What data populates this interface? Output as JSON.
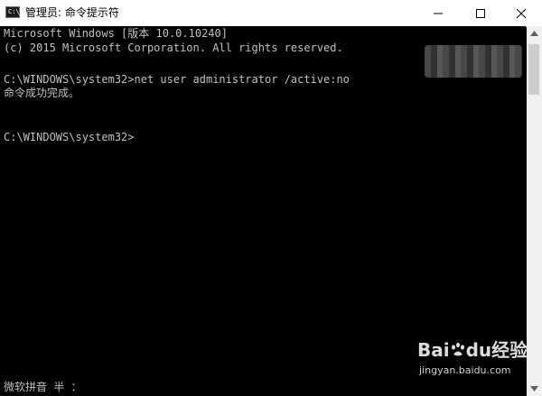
{
  "window": {
    "title": "管理员: 命令提示符",
    "icon": "console-icon",
    "icon_text": "C:\\_",
    "controls": {
      "minimize": "minimize-icon",
      "maximize": "maximize-icon",
      "close": "close-icon"
    }
  },
  "console": {
    "lines": [
      "Microsoft Windows [版本 10.0.10240]",
      "(c) 2015 Microsoft Corporation. All rights reserved.",
      "",
      "C:\\WINDOWS\\system32>net user administrator /active:no",
      "命令成功完成。",
      "",
      "",
      "C:\\WINDOWS\\system32>"
    ],
    "ime_status": "微软拼音 半 ："
  },
  "watermark": {
    "logo": "Bai  经验",
    "logo_part1": "Bai",
    "logo_part2": "du",
    "logo_part3": "经验",
    "subtext": "jingyan.baidu.com"
  },
  "colors": {
    "console_bg": "#000000",
    "console_text": "#c0c0c0",
    "titlebar_bg": "#ffffff"
  }
}
